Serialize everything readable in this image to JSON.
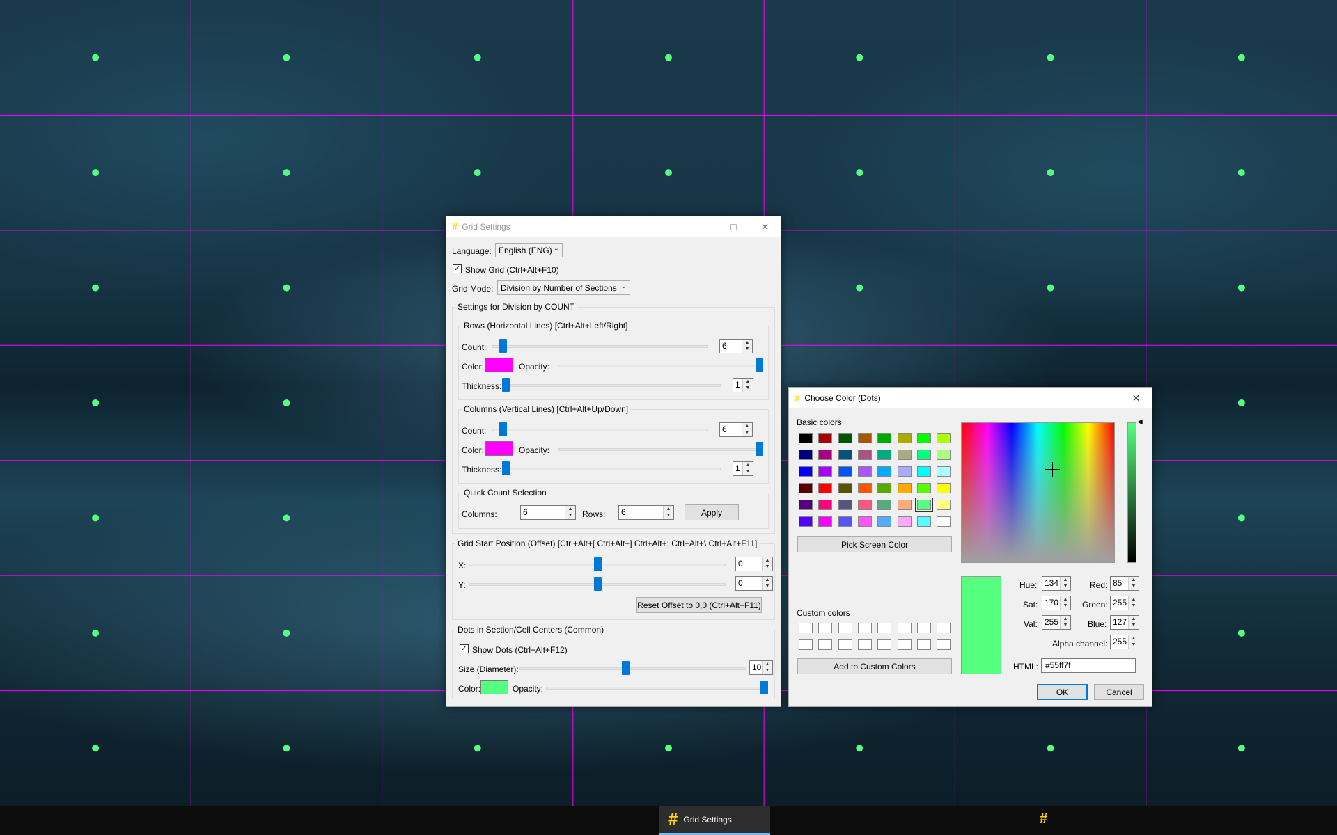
{
  "grid_settings": {
    "title": "Grid Settings",
    "language_label": "Language:",
    "language_value": "English (ENG)",
    "show_grid_label": "Show Grid (Ctrl+Alt+F10)",
    "show_grid_checked": true,
    "grid_mode_label": "Grid Mode:",
    "grid_mode_value": "Division by Number of Sections",
    "count_settings_title": "Settings for Division by COUNT",
    "rows": {
      "title": "Rows (Horizontal Lines) [Ctrl+Alt+Left/Right]",
      "count_label": "Count:",
      "count_value": "6",
      "count_level": 0.03,
      "color_label": "Color:",
      "color": "#ff00ff",
      "opacity_label": "Opacity:",
      "opacity_level": 1.0,
      "thickness_label": "Thickness:",
      "thickness_value": "1",
      "thickness_level": 0.0
    },
    "columns": {
      "title": "Columns (Vertical Lines) [Ctrl+Alt+Up/Down]",
      "count_label": "Count:",
      "count_value": "6",
      "count_level": 0.03,
      "color_label": "Color:",
      "color": "#ff00ff",
      "opacity_label": "Opacity:",
      "opacity_level": 1.0,
      "thickness_label": "Thickness:",
      "thickness_value": "1",
      "thickness_level": 0.0
    },
    "quick": {
      "title": "Quick Count Selection",
      "columns_label": "Columns:",
      "columns_value": "6",
      "rows_label": "Rows:",
      "rows_value": "6",
      "apply_label": "Apply"
    },
    "offset": {
      "title": "Grid Start Position (Offset) [Ctrl+Alt+[ Ctrl+Alt+] Ctrl+Alt+; Ctrl+Alt+\\ Ctrl+Alt+F11]",
      "x_label": "X:",
      "x_value": "0",
      "x_level": 0.5,
      "y_label": "Y:",
      "y_value": "0",
      "y_level": 0.5,
      "reset_label": "Reset Offset to 0,0 (Ctrl+Alt+F11)"
    },
    "dots": {
      "title": "Dots in Section/Cell Centers (Common)",
      "show_label": "Show Dots (Ctrl+Alt+F12)",
      "show_checked": true,
      "size_label": "Size (Diameter):",
      "size_value": "10",
      "size_level": 0.47,
      "color_label": "Color:",
      "color": "#55ff7f",
      "opacity_label": "Opacity:",
      "opacity_level": 1.0
    }
  },
  "color_dialog": {
    "title": "Choose Color (Dots)",
    "basic_colors_label": "Basic colors",
    "basic_colors": [
      "#000000",
      "#aa0000",
      "#005500",
      "#aa5500",
      "#00aa00",
      "#aaaa00",
      "#00ff00",
      "#aaff00",
      "#00007f",
      "#aa007f",
      "#00557f",
      "#aa557f",
      "#00aa7f",
      "#aaaa7f",
      "#00ff7f",
      "#aaff7f",
      "#0000ff",
      "#aa00ff",
      "#0055ff",
      "#aa55ff",
      "#00aaff",
      "#aaaaff",
      "#00ffff",
      "#aaffff",
      "#550000",
      "#ff0000",
      "#555500",
      "#ff5500",
      "#55aa00",
      "#ffaa00",
      "#55ff00",
      "#ffff00",
      "#55007f",
      "#ff007f",
      "#55557f",
      "#ff557f",
      "#55aa7f",
      "#ffaa7f",
      "#55ff7f",
      "#ffff7f",
      "#5500ff",
      "#ff00ff",
      "#5555ff",
      "#ff55ff",
      "#55aaff",
      "#ffaaff",
      "#55ffff",
      "#ffffff"
    ],
    "selected_basic_index": 38,
    "pick_screen_label": "Pick Screen Color",
    "custom_colors_label": "Custom colors",
    "add_custom_label": "Add to Custom Colors",
    "current_color": "#55ff7f",
    "hue_label": "Hue:",
    "hue_value": "134",
    "sat_label": "Sat:",
    "sat_value": "170",
    "val_label": "Val:",
    "val_value": "255",
    "red_label": "Red:",
    "red_value": "85",
    "green_label": "Green:",
    "green_value": "255",
    "blue_label": "Blue:",
    "blue_value": "127",
    "alpha_label": "Alpha channel:",
    "alpha_value": "255",
    "html_label": "HTML:",
    "html_value": "#55ff7f",
    "ok_label": "OK",
    "cancel_label": "Cancel"
  },
  "taskbar": {
    "app_label": "Grid Settings",
    "app_icon": "hash-icon",
    "tray_icon": "hash-icon"
  },
  "overlay": {
    "line_color": "#ff00ff",
    "dot_color": "#55ff7f",
    "rows": 6,
    "columns": 6
  }
}
